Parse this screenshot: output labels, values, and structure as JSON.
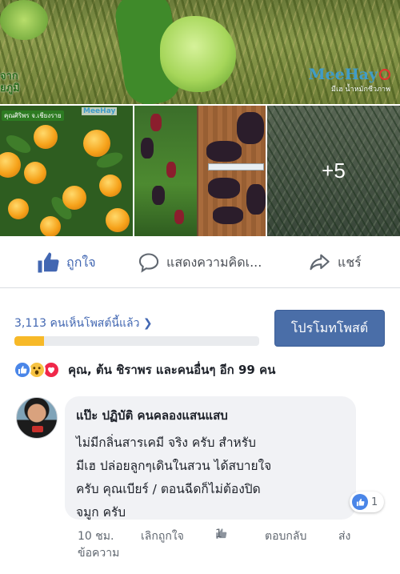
{
  "hero": {
    "left_caption_line1": "จาก",
    "left_caption_line2": "ยภูมิ",
    "brand_name": "MeeHay",
    "brand_thai": "มีเฮ",
    "brand_tagline": "มีเฮ น้ำหมักชีวภาพ"
  },
  "gallery": {
    "tile1_caption": "คุณศิริพร จ.เชียงราย",
    "tile1_logo": "MeeHay",
    "more_count": "+5"
  },
  "actions": {
    "like": "ถูกใจ",
    "comment": "แสดงความคิดเ...",
    "share": "แชร์"
  },
  "reach": {
    "text": "3,113 คนเห็นโพสต์นี้แล้ว",
    "progress_fraction": 0.12,
    "promote_button": "โปรโมทโพสต์"
  },
  "reactions": {
    "summary": "คุณ, ต้น ชิราพร และคนอื่นๆ อีก 99 คน"
  },
  "comment": {
    "author": "แป๊ะ ปฏิบัติ คนคลองแสนแสบ",
    "body": "ไม่มีกลิ่นสารเคมี จริง ครับ  สำหรับ\nมีเฮ ปล่อยลูกๆเดินในสวน ได้สบายใจ\nครับ คุณเบียร์ / ตอนฉีดก็ไม่ต้องปิด\nจมูก ครับ",
    "like_count": "1",
    "time": "10 ชม.",
    "unlike": "เลิกถูกใจ",
    "meta_like_count": "1",
    "reply": "ตอบกลับ",
    "send_line1": "ส่ง",
    "send_line2": "ข้อความ"
  },
  "colors": {
    "facebook_blue": "#4267b2",
    "promote_button": "#4a6ea8",
    "progress_fill": "#f7b928",
    "bubble_bg": "#f1f2f5"
  }
}
